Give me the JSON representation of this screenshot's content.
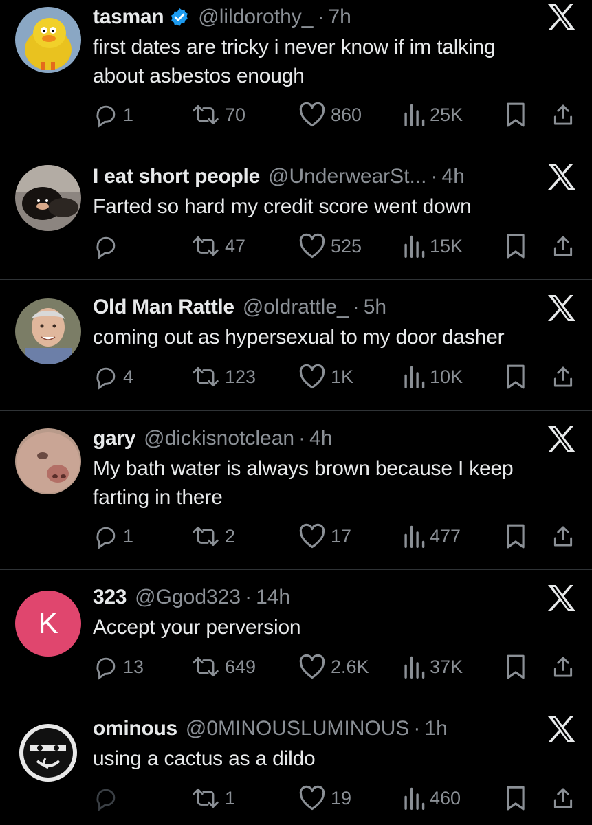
{
  "tweets": [
    {
      "name": "tasman",
      "verified": true,
      "handle": "@lildorothy_",
      "dot": "·",
      "age": "7h",
      "text_lines": [
        "first dates are tricky i never know if im talking",
        "about asbestos enough"
      ],
      "replies": "1",
      "reposts": "70",
      "likes": "860",
      "views": "25K",
      "avatar_icon": "yellow-bird-avatar"
    },
    {
      "name": "I eat short people",
      "verified": false,
      "handle": "@UnderwearSt...",
      "dot": "·",
      "age": "4h",
      "text_lines": [
        "Farted so hard my credit score went down"
      ],
      "replies": "",
      "reposts": "47",
      "likes": "525",
      "views": "15K",
      "avatar_icon": "dark-creature-avatar"
    },
    {
      "name": "Old Man Rattle",
      "verified": false,
      "handle": "@oldrattle_",
      "dot": "·",
      "age": "5h",
      "text_lines": [
        "coming out as hypersexual to my door dasher"
      ],
      "replies": "4",
      "reposts": "123",
      "likes": "1K",
      "views": "10K",
      "avatar_icon": "old-man-avatar"
    },
    {
      "name": "gary",
      "verified": false,
      "handle": "@dickisnotclean",
      "dot": "·",
      "age": "4h",
      "text_lines": [
        "My bath water is always brown because I keep",
        "farting in there"
      ],
      "replies": "1",
      "reposts": "2",
      "likes": "17",
      "views": "477",
      "avatar_icon": "face-closeup-avatar"
    },
    {
      "name": "323",
      "verified": false,
      "handle": "@Ggod323",
      "dot": "·",
      "age": "14h",
      "text_lines": [
        "Accept your perversion"
      ],
      "replies": "13",
      "reposts": "649",
      "likes": "2.6K",
      "views": "37K",
      "avatar_letter": "K",
      "avatar_icon": "letter-avatar"
    },
    {
      "name": "ominous",
      "verified": false,
      "handle": "@0MINOUSLUMINOUS",
      "dot": "·",
      "age": "1h",
      "text_lines": [
        "using a cactus as a dildo"
      ],
      "replies": "",
      "reposts": "1",
      "likes": "19",
      "views": "460",
      "avatar_icon": "masked-face-avatar"
    }
  ],
  "colors": {
    "background": "#000000",
    "text": "#e7e9ea",
    "muted": "#8b9096",
    "divider": "#2f3336",
    "verified": "#1d9bf0",
    "letter_avatar": "#e0466e"
  },
  "icons": [
    "reply-icon",
    "repost-icon",
    "like-icon",
    "views-icon",
    "bookmark-icon",
    "share-icon",
    "x-logo-icon",
    "verified-badge-icon"
  ]
}
